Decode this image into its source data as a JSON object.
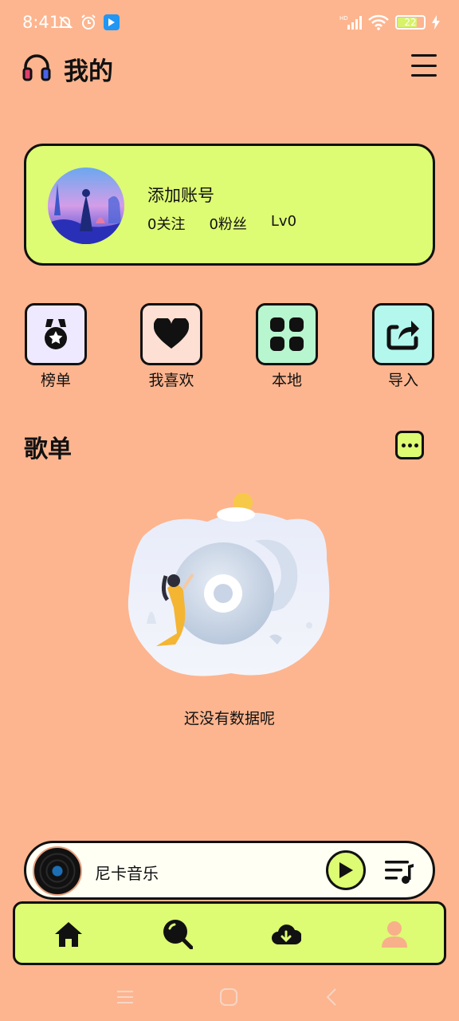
{
  "status_bar": {
    "time": "8:41",
    "battery": "22",
    "network_badge": "HD",
    "icons": [
      "mute-bell-icon",
      "alarm-icon",
      "app-notification-icon",
      "signal-icon",
      "wifi-icon",
      "battery-icon",
      "charging-icon"
    ]
  },
  "header": {
    "title": "我的",
    "icon": "headphones-icon",
    "menu_icon": "hamburger-menu-icon"
  },
  "profile": {
    "name": "添加账号",
    "follows": "0关注",
    "fans": "0粉丝",
    "level": "Lv0"
  },
  "quick_actions": [
    {
      "label": "榜单",
      "icon": "medal-icon",
      "color": "#EFE9FF"
    },
    {
      "label": "我喜欢",
      "icon": "heart-icon",
      "color": "#FDDFD3"
    },
    {
      "label": "本地",
      "icon": "grid-icon",
      "color": "#B8F6CF"
    },
    {
      "label": "导入",
      "icon": "share-import-icon",
      "color": "#B4F7EC"
    }
  ],
  "playlist_section": {
    "title": "歌单",
    "more_icon": "more-dots-icon",
    "empty_text": "还没有数据呢"
  },
  "player": {
    "title": "尼卡音乐",
    "play_icon": "play-icon",
    "queue_icon": "playlist-queue-icon"
  },
  "tab_bar": [
    {
      "icon": "home-icon",
      "active": false
    },
    {
      "icon": "search-icon",
      "active": false
    },
    {
      "icon": "cloud-download-icon",
      "active": false
    },
    {
      "icon": "user-icon",
      "active": true
    }
  ],
  "system_nav": [
    "recent-apps-icon",
    "home-circle-icon",
    "back-icon"
  ],
  "colors": {
    "background": "#FDB58F",
    "accent": "#DDFB73",
    "active_tab": "#F8B08A",
    "outline": "#111111"
  }
}
